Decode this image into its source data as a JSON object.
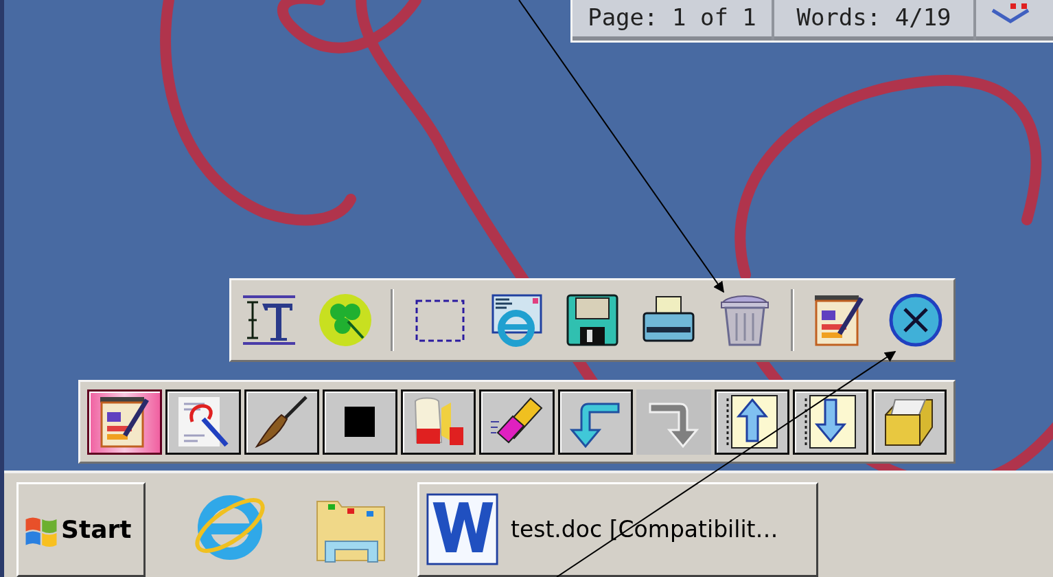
{
  "status_bar": {
    "fields": [
      "Page: 1 of 1",
      "Words: 4/19"
    ]
  },
  "toolbar_top": {
    "buttons": [
      {
        "kind": "text"
      },
      {
        "kind": "clover"
      },
      {
        "kind": "select"
      },
      {
        "kind": "mail"
      },
      {
        "kind": "save"
      },
      {
        "kind": "print"
      },
      {
        "kind": "trash"
      },
      {
        "kind": "paint"
      },
      {
        "kind": "close"
      }
    ]
  },
  "toolbar_bottom": {
    "buttons": [
      {
        "kind": "paint",
        "selected": true,
        "disabled": false
      },
      {
        "kind": "lasso",
        "selected": false,
        "disabled": false
      },
      {
        "kind": "brush",
        "selected": false,
        "disabled": false
      },
      {
        "kind": "square",
        "selected": false,
        "disabled": false
      },
      {
        "kind": "spray",
        "selected": false,
        "disabled": false
      },
      {
        "kind": "eraser",
        "selected": false,
        "disabled": false
      },
      {
        "kind": "undo",
        "selected": false,
        "disabled": false
      },
      {
        "kind": "redo",
        "selected": false,
        "disabled": true
      },
      {
        "kind": "up",
        "selected": false,
        "disabled": false
      },
      {
        "kind": "down",
        "selected": false,
        "disabled": false
      },
      {
        "kind": "box",
        "selected": false,
        "disabled": false
      }
    ]
  },
  "taskbar": {
    "start": "Start",
    "tasks": [
      {
        "title": "test.doc [Compatibilit…"
      }
    ]
  }
}
